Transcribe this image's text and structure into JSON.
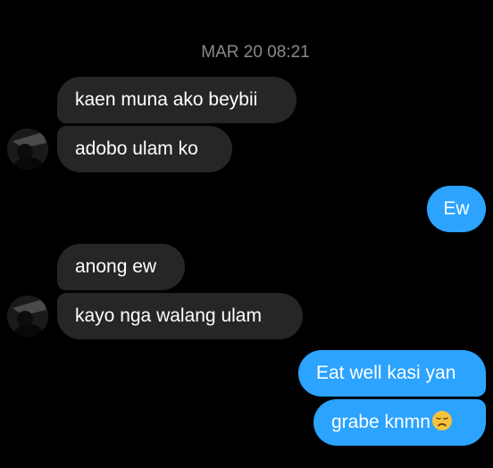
{
  "chat": {
    "timestamp": "MAR 20 08:21",
    "messages": [
      {
        "sender": "them",
        "text": "kaen muna ako beybii"
      },
      {
        "sender": "them",
        "text": "adobo ulam ko"
      },
      {
        "sender": "me",
        "text": "Ew"
      },
      {
        "sender": "them",
        "text": "anong ew"
      },
      {
        "sender": "them",
        "text": "kayo nga walang ulam"
      },
      {
        "sender": "me",
        "text": "Eat well kasi yan"
      },
      {
        "sender": "me",
        "text": "grabe knmn",
        "emoji": "disappointed-face"
      }
    ]
  },
  "colors": {
    "background": "#000000",
    "incoming_bubble": "#262626",
    "outgoing_bubble": "#2ba3ff",
    "timestamp": "#8a8a8a"
  }
}
